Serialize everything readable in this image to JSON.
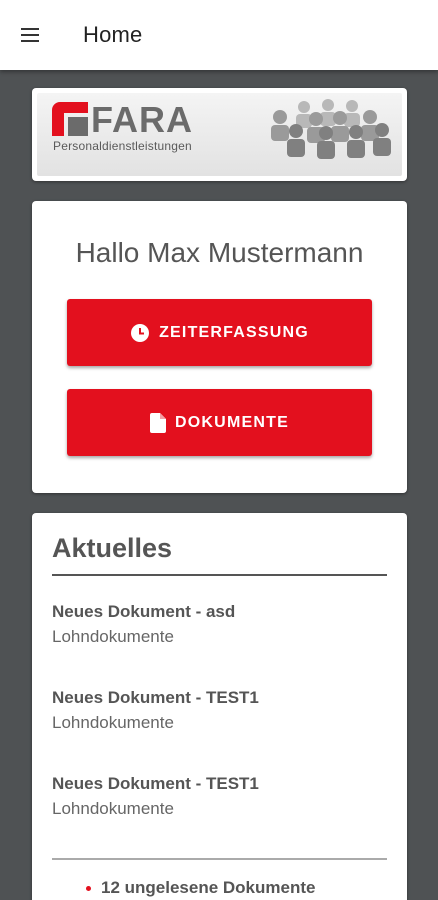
{
  "appbar": {
    "title": "Home",
    "menu_icon": "hamburger-icon"
  },
  "logo": {
    "brand": "FARA",
    "subtitle": "Personaldienstleistungen",
    "accent": "#e3101e"
  },
  "greeting": "Hallo Max Mustermann",
  "buttons": {
    "time_tracking": {
      "label": "ZEITERFASSUNG",
      "icon": "clock-icon"
    },
    "documents": {
      "label": "DOKUMENTE",
      "icon": "document-icon"
    }
  },
  "news": {
    "title": "Aktuelles",
    "items": [
      {
        "title": "Neues Dokument - asd",
        "category": "Lohndokumente"
      },
      {
        "title": "Neues Dokument - TEST1",
        "category": "Lohndokumente"
      },
      {
        "title": "Neues Dokument - TEST1",
        "category": "Lohndokumente"
      }
    ],
    "unread": "12 ungelesene Dokumente"
  },
  "colors": {
    "primary": "#e3101e",
    "background": "#4f5254",
    "text": "#555555"
  }
}
